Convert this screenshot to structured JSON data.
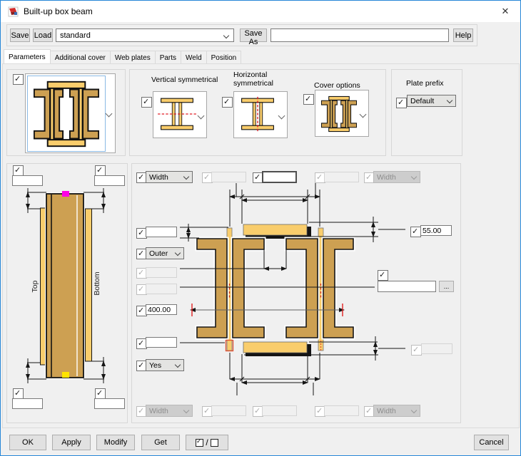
{
  "window": {
    "title": "Built-up box beam",
    "close_glyph": "✕"
  },
  "toolbar": {
    "save": "Save",
    "load": "Load",
    "preset": {
      "value": "standard"
    },
    "save_as": "Save As",
    "save_as_field": {
      "value": ""
    },
    "help": "Help"
  },
  "tabs": {
    "items": [
      {
        "label": "Parameters",
        "active": true
      },
      {
        "label": "Additional cover",
        "active": false
      },
      {
        "label": "Web plates",
        "active": false
      },
      {
        "label": "Parts",
        "active": false
      },
      {
        "label": "Weld",
        "active": false
      },
      {
        "label": "Position",
        "active": false
      }
    ]
  },
  "preview": {
    "checked": true
  },
  "symmetry": {
    "vertical": {
      "label": "Vertical symmetrical",
      "checked": true
    },
    "horizontal": {
      "label": "Horizontal symmetrical",
      "checked": true
    },
    "cover": {
      "label": "Cover options",
      "checked": true
    }
  },
  "plate_prefix": {
    "label": "Plate prefix",
    "checked": true,
    "value": "Default"
  },
  "elevation": {
    "top_label": "Top",
    "bottom_label": "Bottom",
    "top_left": {
      "checked": true,
      "value": ""
    },
    "top_right": {
      "checked": true,
      "value": ""
    },
    "bottom_left": {
      "checked": true,
      "value": ""
    },
    "bottom_right": {
      "checked": true,
      "value": ""
    }
  },
  "section": {
    "top_row": [
      {
        "type": "select",
        "checked": true,
        "enabled": true,
        "value": "Width"
      },
      {
        "type": "input",
        "checked": true,
        "enabled": false,
        "value": ""
      },
      {
        "type": "input",
        "checked": true,
        "enabled": true,
        "value": ""
      },
      {
        "type": "input",
        "checked": true,
        "enabled": false,
        "value": ""
      },
      {
        "type": "select",
        "checked": true,
        "enabled": false,
        "value": "Width"
      }
    ],
    "bottom_row": [
      {
        "type": "select",
        "checked": true,
        "enabled": false,
        "value": "Width"
      },
      {
        "type": "input",
        "checked": true,
        "enabled": false,
        "value": ""
      },
      {
        "type": "input",
        "checked": true,
        "enabled": false,
        "value": ""
      },
      {
        "type": "input",
        "checked": true,
        "enabled": false,
        "value": ""
      },
      {
        "type": "select",
        "checked": true,
        "enabled": false,
        "value": "Width"
      }
    ],
    "left_rows": [
      {
        "type": "input",
        "checked": true,
        "enabled": true,
        "value": ""
      },
      {
        "type": "select",
        "checked": true,
        "enabled": true,
        "value": "Outer"
      },
      {
        "type": "input",
        "checked": true,
        "enabled": false,
        "value": ""
      },
      {
        "type": "input",
        "checked": true,
        "enabled": false,
        "value": ""
      },
      {
        "type": "input",
        "checked": true,
        "enabled": true,
        "value": "400.00"
      },
      {
        "type": "input",
        "checked": true,
        "enabled": true,
        "value": ""
      },
      {
        "type": "select",
        "checked": true,
        "enabled": true,
        "value": "Yes"
      }
    ],
    "right": {
      "thickness_top": {
        "checked": true,
        "value": "55.00"
      },
      "cover_profile": {
        "checked": true,
        "value": "",
        "browse_label": "..."
      },
      "thickness_bottom": {
        "checked": true,
        "enabled": false,
        "value": ""
      }
    }
  },
  "footer": {
    "ok": "OK",
    "apply": "Apply",
    "modify": "Modify",
    "get": "Get",
    "toggle_separator": "/",
    "cancel": "Cancel"
  },
  "colors": {
    "accent_border": "#2787d8",
    "plate_yellow": "#f9cd6c",
    "plate_tan": "#cda052",
    "mark_magenta": "#ff00e6",
    "mark_yellow": "#ffe400",
    "dim_red": "#e03c2a"
  }
}
